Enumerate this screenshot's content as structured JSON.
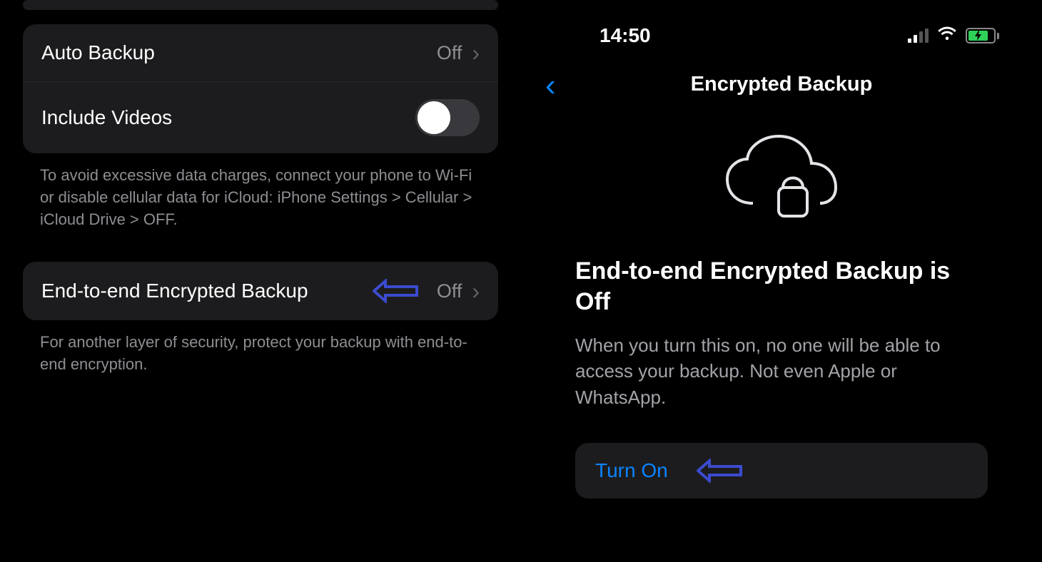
{
  "left": {
    "auto_backup": {
      "label": "Auto Backup",
      "status": "Off"
    },
    "include_videos": {
      "label": "Include Videos",
      "on": false
    },
    "data_note": "To avoid excessive data charges, connect your phone to Wi-Fi or disable cellular data for iCloud: iPhone Settings > Cellular > iCloud Drive > OFF.",
    "e2e": {
      "label": "End-to-end Encrypted Backup",
      "status": "Off"
    },
    "e2e_note": "For another layer of security, protect your backup with end-to-end encryption."
  },
  "right": {
    "status_time": "14:50",
    "header_title": "Encrypted Backup",
    "heading": "End-to-end Encrypted Backup is Off",
    "description": "When you turn this on, no one will be able to access your backup. Not even Apple or WhatsApp.",
    "turn_on_label": "Turn On"
  }
}
